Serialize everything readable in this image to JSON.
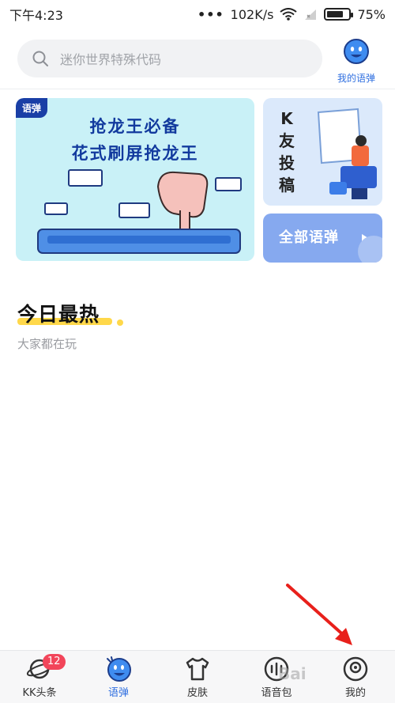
{
  "status_bar": {
    "time": "下午4:23",
    "network_speed": "102K/s",
    "battery": "75%",
    "battery_level": 0.75
  },
  "header": {
    "search_placeholder": "迷你世界特殊代码",
    "my_yudan_label": "我的语弹"
  },
  "banners": {
    "main": {
      "tag": "语弹",
      "line1": "抢龙王必备",
      "line2": "花式刷屏抢龙王"
    },
    "contribute": {
      "chars": [
        "K",
        "友",
        "投",
        "稿"
      ]
    },
    "all": {
      "label": "全部语弹"
    }
  },
  "hot": {
    "title": "今日最热",
    "subtitle": "大家都在玩"
  },
  "bottom_nav": {
    "items": [
      {
        "label": "KK头条",
        "icon": "planet-icon",
        "badge": "12"
      },
      {
        "label": "语弹",
        "icon": "yudan-icon",
        "active": true
      },
      {
        "label": "皮肤",
        "icon": "shirt-icon"
      },
      {
        "label": "语音包",
        "icon": "voice-pack-icon"
      },
      {
        "label": "我的",
        "icon": "profile-icon"
      }
    ]
  },
  "watermark": "Bai"
}
